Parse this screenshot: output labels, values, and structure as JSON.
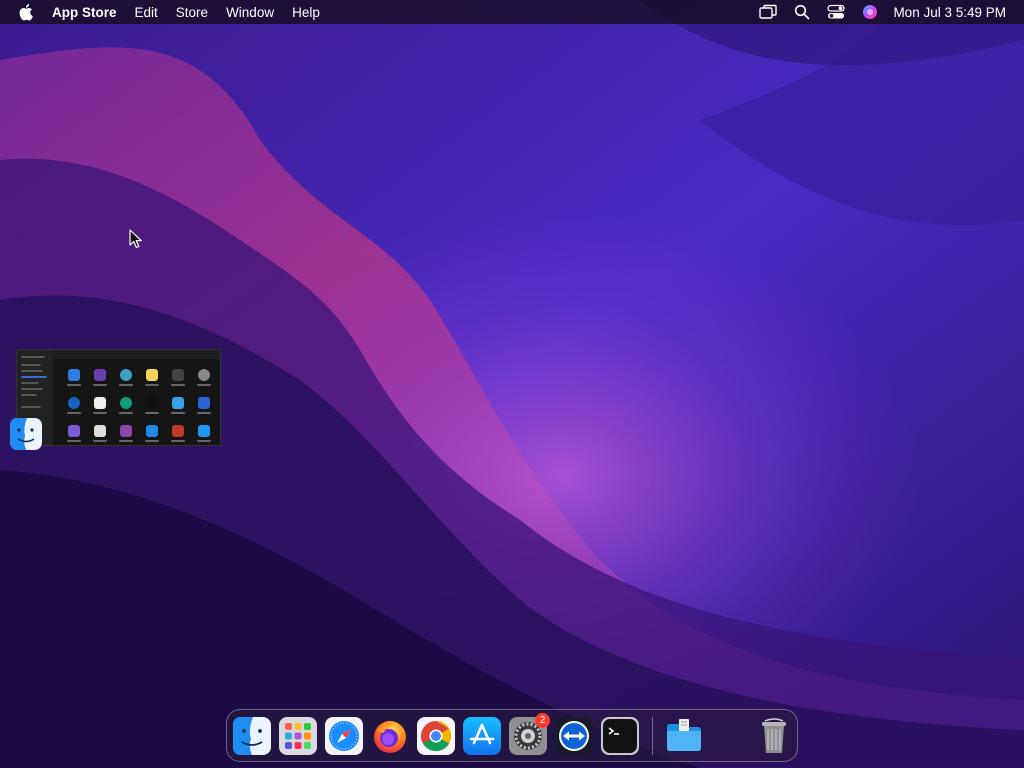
{
  "menubar": {
    "app_name": "App Store",
    "items": [
      "Edit",
      "Store",
      "Window",
      "Help"
    ],
    "clock": "Mon Jul 3  5:49 PM"
  },
  "dock": {
    "items": [
      {
        "name": "Finder",
        "icon": "finder-icon"
      },
      {
        "name": "Launchpad",
        "icon": "launchpad-icon"
      },
      {
        "name": "Safari",
        "icon": "safari-icon"
      },
      {
        "name": "Firefox",
        "icon": "firefox-icon"
      },
      {
        "name": "Chrome",
        "icon": "chrome-icon"
      },
      {
        "name": "App Store",
        "icon": "app-store-icon"
      },
      {
        "name": "System Settings",
        "icon": "system-settings-icon"
      },
      {
        "name": "TeamViewer",
        "icon": "teamviewer-icon"
      },
      {
        "name": "Terminal",
        "icon": "terminal-icon"
      },
      {
        "name": "Downloads",
        "icon": "downloads-folder-icon"
      },
      {
        "name": "Trash",
        "icon": "trash-icon"
      }
    ],
    "system_settings_badge": "2"
  },
  "colors": {
    "menubar_bg": "#140c1e",
    "wallpaper_dark": "#1b0a45",
    "wallpaper_magenta": "#9b2a8a",
    "wallpaper_purple": "#6a2fd6",
    "badge": "#ff3b30"
  }
}
